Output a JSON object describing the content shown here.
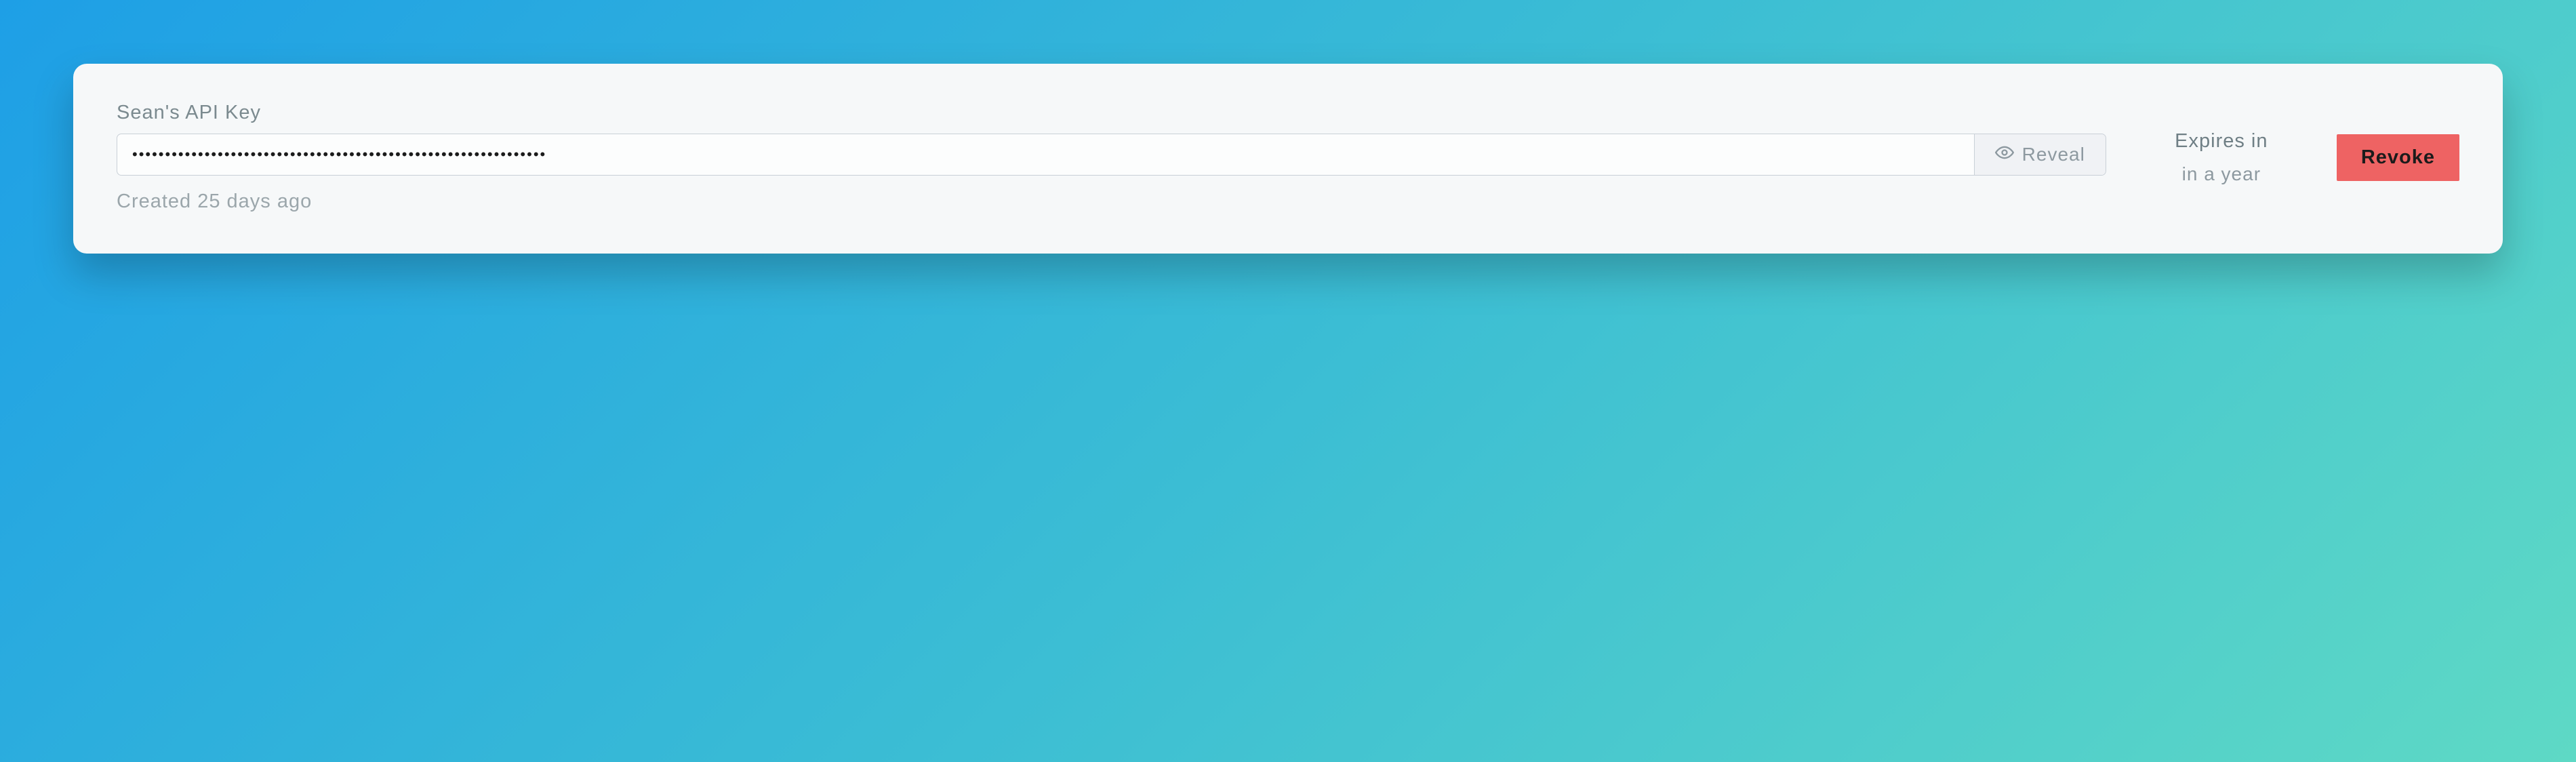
{
  "apiKey": {
    "label": "Sean's API Key",
    "masked_value": "•••••••••••••••••••••••••••••••••••••••••••••••••••••••••••••••",
    "reveal_label": "Reveal",
    "created_text": "Created 25 days ago"
  },
  "expiry": {
    "label": "Expires in",
    "value": "in a year"
  },
  "actions": {
    "revoke_label": "Revoke"
  }
}
